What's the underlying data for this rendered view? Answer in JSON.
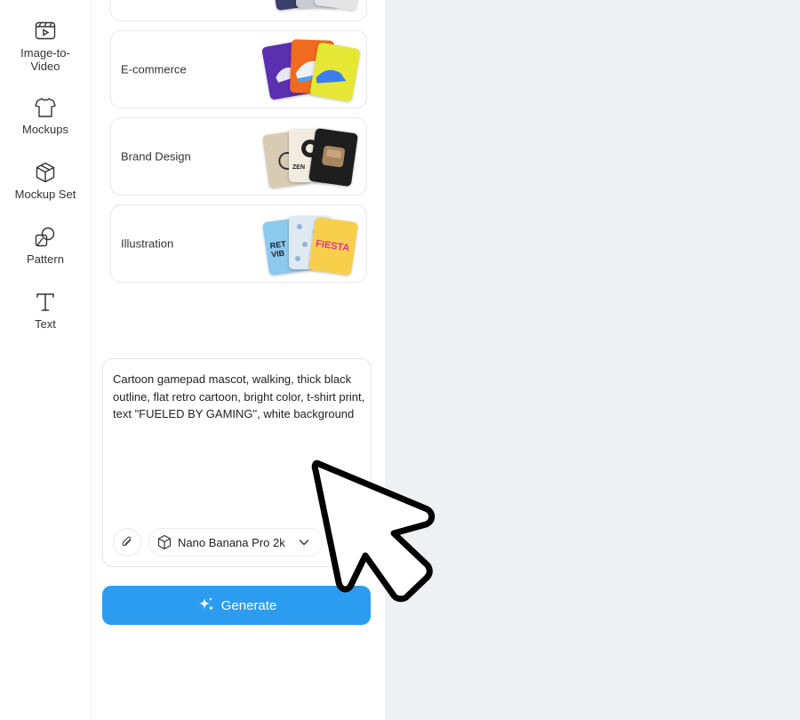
{
  "rail": {
    "items": [
      {
        "label": "Image-to-\nVideo",
        "icon": "video-icon"
      },
      {
        "label": "Mockups",
        "icon": "tshirt-icon"
      },
      {
        "label": "Mockup Set",
        "icon": "cube-icon"
      },
      {
        "label": "Pattern",
        "icon": "pattern-icon"
      },
      {
        "label": "Text",
        "icon": "text-icon"
      }
    ]
  },
  "categories": [
    {
      "label": "E-commerce"
    },
    {
      "label": "Brand Design",
      "thumb_texts": [
        "ZEN"
      ]
    },
    {
      "label": "Illustration",
      "thumb_texts": [
        "RET VIB",
        "FIESTA"
      ]
    }
  ],
  "prompt": {
    "value": "Cartoon gamepad mascot, walking, thick black outline, flat retro cartoon, bright color, t-shirt print, text \"FUELED BY GAMING\", white background"
  },
  "model": {
    "label": "Nano Banana Pro 2k"
  },
  "generate": {
    "label": "Generate"
  },
  "colors": {
    "accent": "#2c9cf0",
    "background": "#eef1f4"
  }
}
